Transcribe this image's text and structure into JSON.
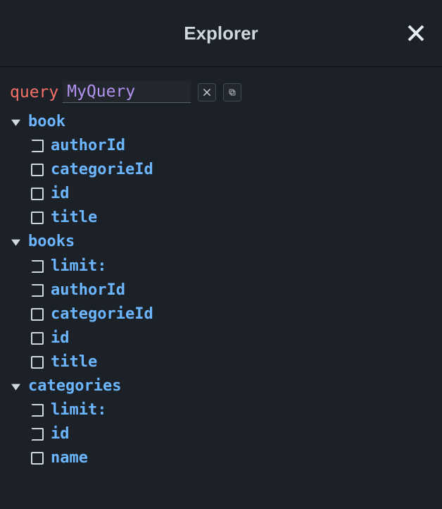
{
  "header": {
    "title": "Explorer"
  },
  "query": {
    "keyword": "query",
    "name": "MyQuery"
  },
  "tree": [
    {
      "name": "book",
      "expanded": true,
      "fields": [
        {
          "name": "authorId",
          "style": "soft"
        },
        {
          "name": "categorieId",
          "style": "box"
        },
        {
          "name": "id",
          "style": "box"
        },
        {
          "name": "title",
          "style": "box"
        }
      ]
    },
    {
      "name": "books",
      "expanded": true,
      "fields": [
        {
          "name": "limit:",
          "style": "soft"
        },
        {
          "name": "authorId",
          "style": "soft"
        },
        {
          "name": "categorieId",
          "style": "box"
        },
        {
          "name": "id",
          "style": "box"
        },
        {
          "name": "title",
          "style": "box"
        }
      ]
    },
    {
      "name": "categories",
      "expanded": true,
      "fields": [
        {
          "name": "limit:",
          "style": "soft"
        },
        {
          "name": "id",
          "style": "soft"
        },
        {
          "name": "name",
          "style": "box"
        }
      ]
    }
  ]
}
